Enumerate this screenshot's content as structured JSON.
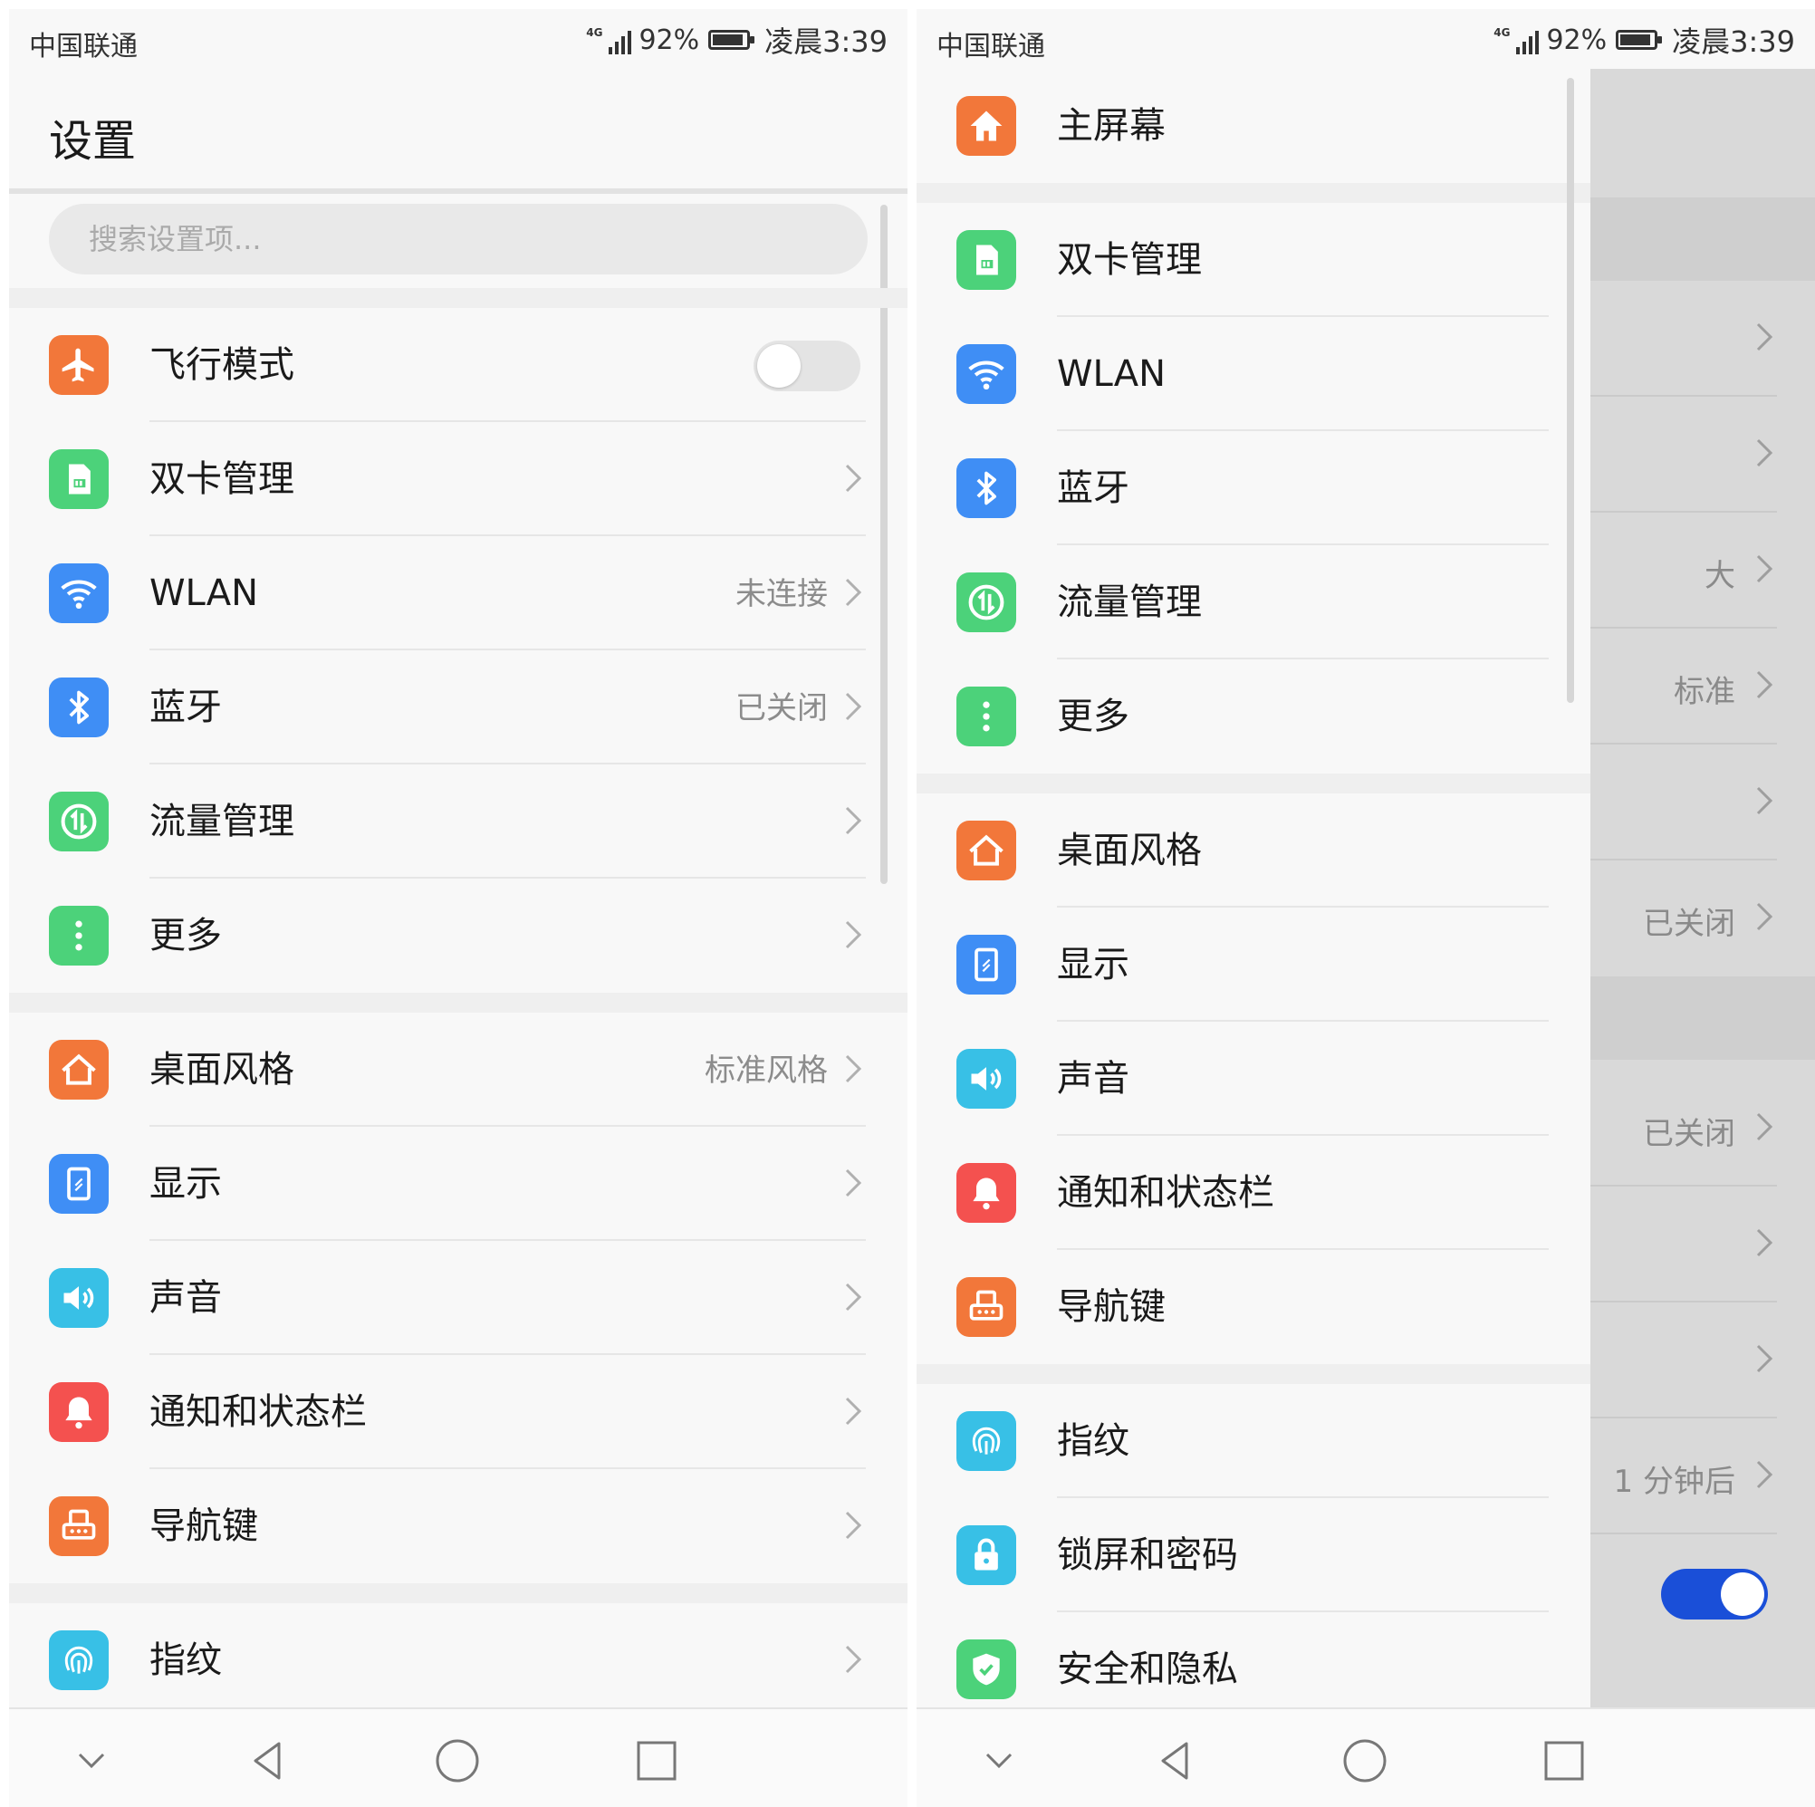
{
  "left": {
    "status": {
      "carrier": "中国联通",
      "network": "4G",
      "battery": "92%",
      "battery_level": 0.92,
      "time": "凌晨3:39"
    },
    "header": {
      "title": "设置"
    },
    "search": {
      "placeholder": "搜索设置项..."
    },
    "items": [
      {
        "label": "飞行模式",
        "value": "",
        "toggle": "off"
      },
      {
        "label": "双卡管理",
        "value": ""
      },
      {
        "label": "WLAN",
        "value": "未连接"
      },
      {
        "label": "蓝牙",
        "value": "已关闭"
      },
      {
        "label": "流量管理",
        "value": ""
      },
      {
        "label": "更多",
        "value": ""
      },
      {
        "label": "桌面风格",
        "value": "标准风格"
      },
      {
        "label": "显示",
        "value": ""
      },
      {
        "label": "声音",
        "value": ""
      },
      {
        "label": "通知和状态栏",
        "value": ""
      },
      {
        "label": "导航键",
        "value": ""
      },
      {
        "label": "指纹",
        "value": ""
      }
    ]
  },
  "right": {
    "status": {
      "carrier": "中国联通",
      "network": "4G",
      "battery": "92%",
      "battery_level": 0.92,
      "time": "凌晨3:39"
    },
    "items": [
      {
        "label": "主屏幕"
      },
      {
        "label": "双卡管理"
      },
      {
        "label": "WLAN"
      },
      {
        "label": "蓝牙"
      },
      {
        "label": "流量管理"
      },
      {
        "label": "更多"
      },
      {
        "label": "桌面风格"
      },
      {
        "label": "显示"
      },
      {
        "label": "声音"
      },
      {
        "label": "通知和状态栏"
      },
      {
        "label": "导航键"
      },
      {
        "label": "指纹"
      },
      {
        "label": "锁屏和密码"
      },
      {
        "label": "安全和隐私"
      }
    ],
    "background_values": [
      "大",
      "标准",
      "已关闭",
      "已关闭",
      "1 分钟后"
    ],
    "background_toggle": "on"
  },
  "colors": {
    "orange": "#f2773a",
    "green": "#4cd27a",
    "blue": "#3f8ef5",
    "teal": "#38c0e6",
    "red": "#f4514f",
    "toggle_on": "#1a4fd8"
  },
  "icons": [
    "airplane-icon",
    "sim-card-icon",
    "wifi-icon",
    "bluetooth-icon",
    "data-usage-icon",
    "more-icon",
    "home-style-icon",
    "display-icon",
    "sound-icon",
    "notification-bell-icon",
    "navigation-key-icon",
    "fingerprint-icon",
    "lock-icon",
    "shield-icon",
    "home-icon",
    "collapse-chevron-icon",
    "back-icon",
    "home-circle-icon",
    "recents-icon"
  ]
}
